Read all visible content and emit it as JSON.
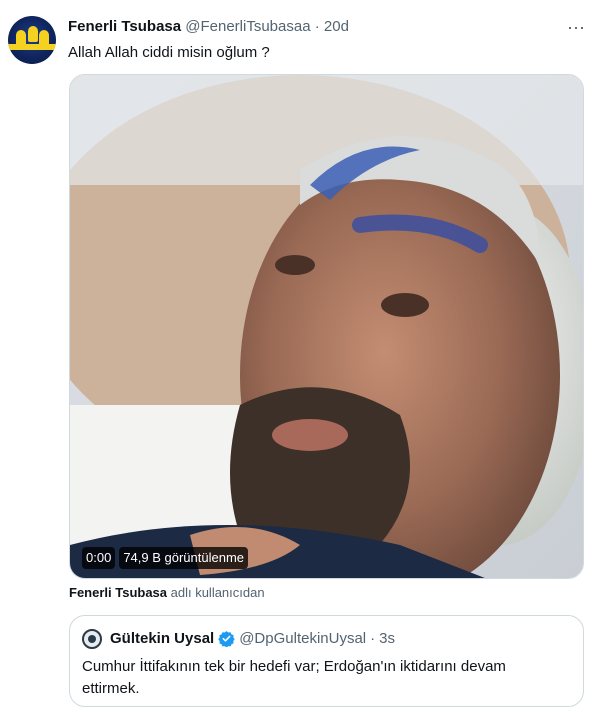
{
  "tweet": {
    "author_name": "Fenerli Tsubasa",
    "handle": "@FenerliTsubasaa",
    "separator": "·",
    "time": "20d",
    "more_icon": "⋯",
    "text": "Allah Allah ciddi misin oğlum ?"
  },
  "video": {
    "time": "0:00",
    "views": "74,9 B görüntülenme"
  },
  "attribution": {
    "name": "Fenerli Tsubasa",
    "suffix": " adlı kullanıcıdan"
  },
  "quote": {
    "author_name": "Gültekin Uysal",
    "handle": "@DpGultekinUysal",
    "separator": "·",
    "time": "3s",
    "text": "Cumhur İttifakının tek bir hedefi var; Erdoğan'ın iktidarını devam ettirmek."
  },
  "colors": {
    "verified": "#1d9bf0",
    "secondary_text": "#536471",
    "border": "#cfd9de"
  }
}
